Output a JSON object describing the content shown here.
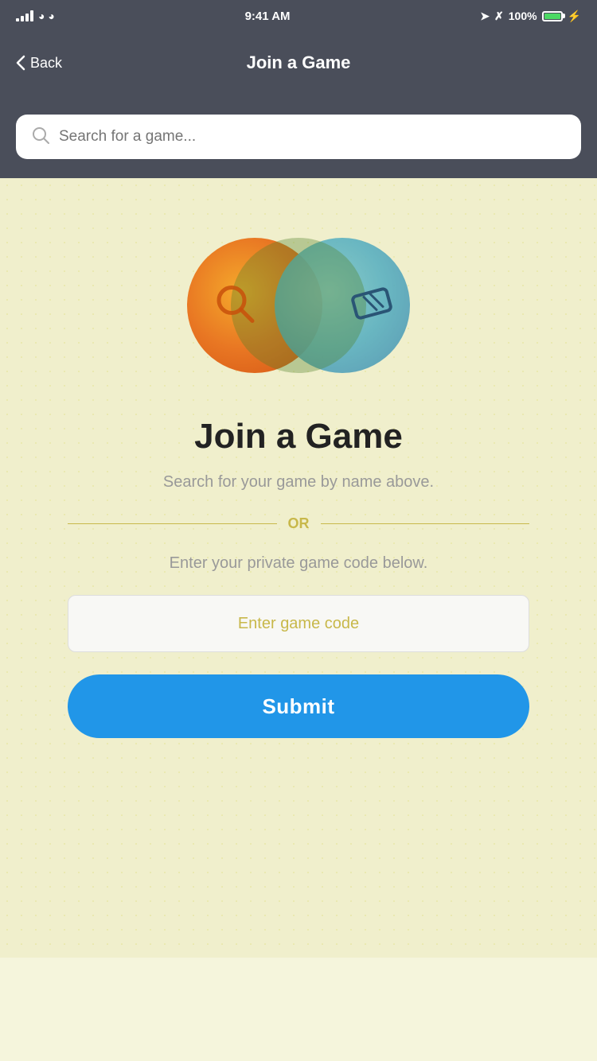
{
  "statusBar": {
    "time": "9:41 AM",
    "battery": "100%"
  },
  "navBar": {
    "backLabel": "Back",
    "title": "Join a Game"
  },
  "searchBar": {
    "placeholder": "Search for a game..."
  },
  "mainContent": {
    "heading": "Join a Game",
    "searchHint": "Search for your game by name above.",
    "orLabel": "OR",
    "enterCodeHint": "Enter your private game code below.",
    "codeInputPlaceholder": "Enter game code",
    "submitLabel": "Submit"
  }
}
